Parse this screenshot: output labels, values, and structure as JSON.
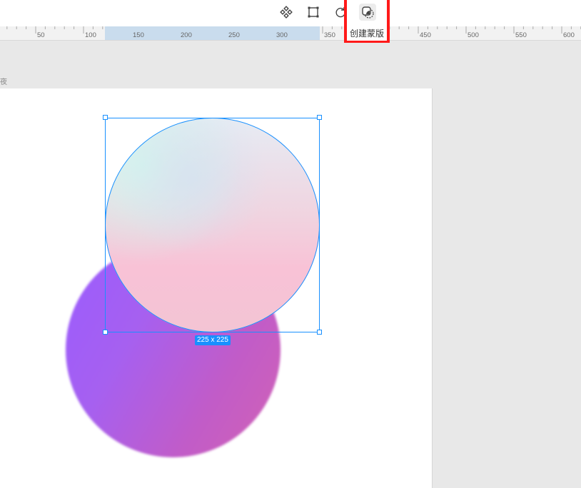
{
  "toolbar": {
    "tools": [
      {
        "name": "component-icon",
        "active": false
      },
      {
        "name": "path-edit-icon",
        "active": false
      },
      {
        "name": "rotate-icon",
        "active": false
      },
      {
        "name": "create-mask-icon",
        "active": true
      }
    ],
    "tooltip": "创建蒙版"
  },
  "ruler": {
    "labels": [
      "50",
      "100",
      "150",
      "200",
      "250",
      "300",
      "350",
      "450",
      "500",
      "550",
      "600"
    ]
  },
  "artboard": {
    "label": "夜"
  },
  "selection": {
    "size_label": "225 x 225"
  },
  "colors": {
    "selection": "#1890ff",
    "highlight": "#ff1a1a"
  }
}
